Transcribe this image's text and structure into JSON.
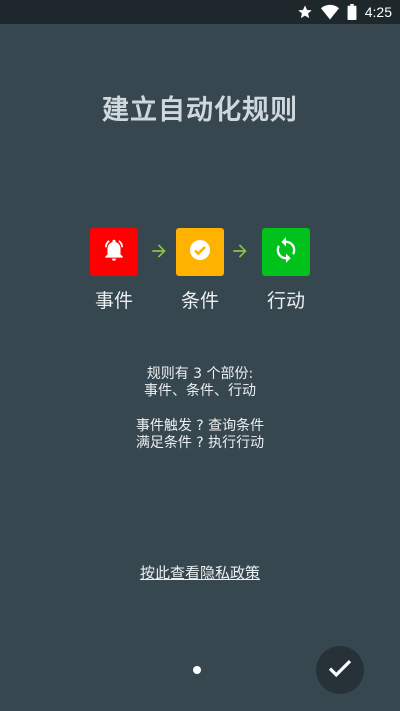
{
  "status_bar": {
    "time": "4:25",
    "icons": [
      "star-icon",
      "wifi-icon",
      "battery-icon"
    ]
  },
  "title": "建立自动化规则",
  "flow": {
    "steps": [
      {
        "label": "事件",
        "icon": "bell-icon",
        "color": "#ff0000"
      },
      {
        "label": "条件",
        "icon": "check-circle-icon",
        "color": "#ffb300"
      },
      {
        "label": "行动",
        "icon": "sync-icon",
        "color": "#00c21a"
      }
    ],
    "arrow_color": "#8bc34a"
  },
  "description": {
    "lines": [
      "规则有 3 个部份:",
      "事件、条件、行动",
      "事件触发 ? 查询条件",
      "满足条件 ? 执行行动"
    ]
  },
  "privacy_link": "按此查看隐私政策",
  "pager": {
    "pages": 1,
    "current": 1
  },
  "colors": {
    "background": "#37474f",
    "status_bar": "#1e282c",
    "done_button": "#263238"
  }
}
